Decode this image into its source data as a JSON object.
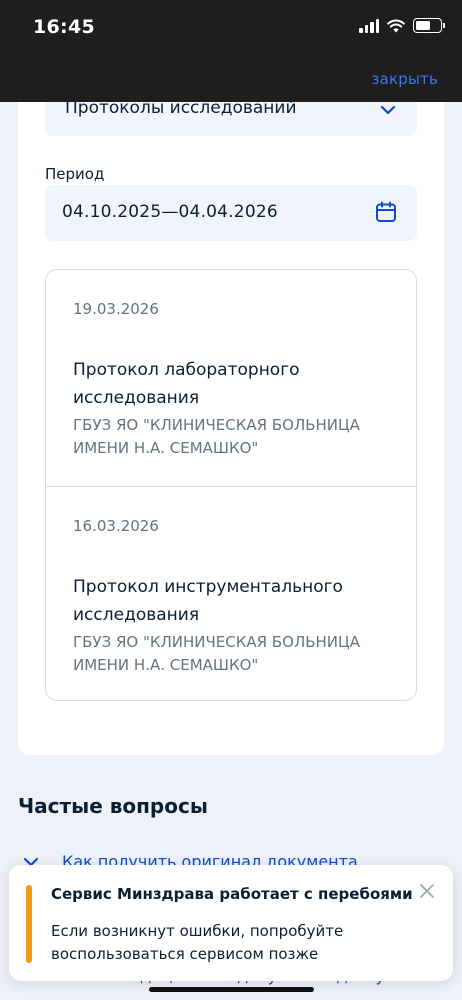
{
  "status_bar": {
    "time": "16:45",
    "signal_icon": "signal-icon",
    "wifi_icon": "wifi-icon",
    "battery_icon": "battery-icon"
  },
  "header": {
    "close_label": "закрыть"
  },
  "filter": {
    "document_type": "Протоколы исследований",
    "period_label": "Период",
    "period_value": "04.10.2025—04.04.2026"
  },
  "results": [
    {
      "date": "19.03.2026",
      "title": "Протокол лабораторного исследования",
      "organization": "ГБУЗ ЯО \"КЛИНИЧЕСКАЯ БОЛЬНИЦА ИМЕНИ Н.А. СЕМАШКО\""
    },
    {
      "date": "16.03.2026",
      "title": "Протокол инструментального исследования",
      "organization": "ГБУЗ ЯО \"КЛИНИЧЕСКАЯ БОЛЬНИЦА ИМЕНИ Н.А. СЕМАШКО\""
    }
  ],
  "faq": {
    "title": "Частые вопросы",
    "items": [
      {
        "text": "Как получить оригинал документа"
      },
      {
        "text": "Какие медицинские документы доступны в"
      }
    ]
  },
  "toast": {
    "title": "Сервис Минздрава работает с перебоями",
    "text": "Если возникнут ошибки, попробуйте воспользоваться сервисом позже",
    "accent_color": "#f49a1b"
  },
  "colors": {
    "link": "#0d4cd3",
    "header_link": "#3778f4",
    "field_bg": "#f1f4fa",
    "page_bg": "#eef2f8"
  }
}
